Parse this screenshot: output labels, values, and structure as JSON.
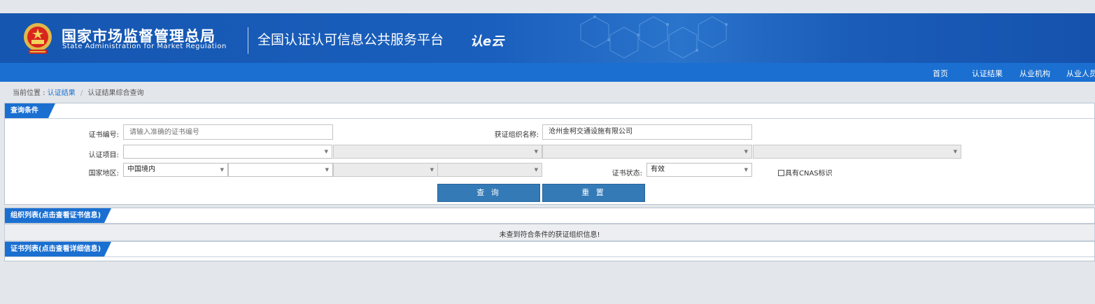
{
  "header": {
    "org_name_cn": "国家市场监督管理总局",
    "org_name_en": "State Administration for Market Regulation",
    "platform_title": "全国认证认可信息公共服务平台",
    "logo_text": "认e云"
  },
  "nav": {
    "items": [
      {
        "label": "首页"
      },
      {
        "label": "认证结果"
      },
      {
        "label": "从业机构"
      },
      {
        "label": "从业人员"
      }
    ]
  },
  "breadcrumb": {
    "prefix": "当前位置 :",
    "link": "认证结果",
    "separator": "/",
    "current": "认证结果综合查询"
  },
  "query_panel": {
    "title": "查询条件",
    "cert_no_label": "证书编号:",
    "cert_no_placeholder": "请输入准确的证书编号",
    "cert_no_value": "",
    "org_name_label": "获证组织名称:",
    "org_name_value": "沧州金柯交通设施有限公司",
    "project_label": "认证项目:",
    "project_selects": [
      "",
      "",
      "",
      ""
    ],
    "region_label": "国家地区:",
    "region_selects": [
      "中国境内",
      "",
      "",
      ""
    ],
    "status_label": "证书状态:",
    "status_value": "有效",
    "cnas_label": "具有CNAS标识",
    "cnas_checked": false,
    "search_button": "查 询",
    "reset_button": "重 置"
  },
  "org_list": {
    "title": "组织列表(点击查看证书信息)",
    "empty_message": "未查到符合条件的获证组织信息!"
  },
  "cert_list": {
    "title": "证书列表(点击查看详细信息)"
  },
  "colors": {
    "banner_blue": "#1556b0",
    "nav_blue": "#1a6fd1",
    "button_blue": "#337ab7",
    "page_bg": "#e3e6ea"
  },
  "icons": {
    "emblem": "national-emblem-icon",
    "dropdown": "chevron-down-icon"
  }
}
